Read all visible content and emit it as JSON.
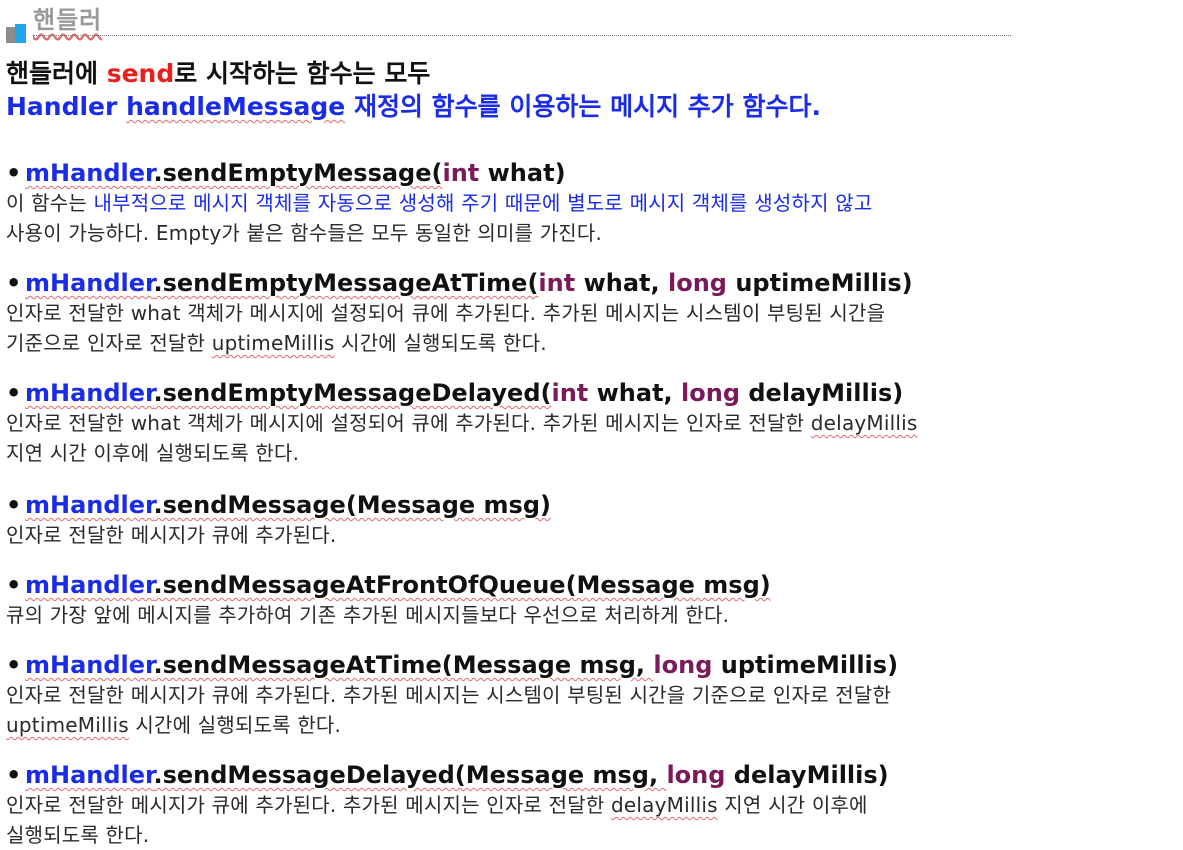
{
  "header": {
    "title": "핸들러"
  },
  "intro": {
    "line1_before": "핸들러에 ",
    "line1_accent": "send",
    "line1_after": "로 시작하는 함수는 모두",
    "line2_word1": "Handler",
    "line2_word2": "handleMessage",
    "line2_rest": " 재정의 함수를 이용하는 메시지 추가 함수다."
  },
  "methods": [
    {
      "object": "mHandler",
      "name": ".sendEmptyMessage(",
      "kw1": "int",
      "mid": " what)",
      "desc1_plain": "이 함수는 ",
      "desc1_blue": "내부적으로 메시지 객체를 자동으로 생성해 주기 때문에 별도로 메시지 객체를 생성하지 않고",
      "desc2": "사용이 가능하다. Empty가 붙은 함수들은 모두 동일한 의미를 가진다."
    },
    {
      "object": "mHandler",
      "name": ".sendEmptyMessageAtTime(",
      "kw1": "int",
      "mid": " what, ",
      "kw2": "long",
      "tail": " uptimeMillis)",
      "desc1": "인자로 전달한 what 객체가 메시지에 설정되어 큐에 추가된다. 추가된 메시지는 시스템이 부팅된 시간을",
      "desc2_before": "기준으로 인자로 전달한 ",
      "desc2_term": "uptimeMillis",
      "desc2_after": " 시간에 실행되도록 한다."
    },
    {
      "object": "mHandler",
      "name": ".sendEmptyMessageDelayed(",
      "kw1": "int",
      "mid": " what, ",
      "kw2": "long",
      "tail": " delayMillis)",
      "desc1_before": "인자로 전달한 what 객체가 메시지에 설정되어 큐에 추가된다. 추가된 메시지는 인자로 전달한 ",
      "desc1_term": "delayMillis",
      "desc2": "지연 시간 이후에 실행되도록 한다."
    },
    {
      "object": "mHandler",
      "name": ".sendMessage(Message msg)",
      "desc1": "인자로 전달한 메시지가 큐에 추가된다."
    },
    {
      "object": "mHandler",
      "name": ".sendMessageAtFrontOfQueue(Message msg)",
      "desc1": "큐의 가장 앞에 메시지를 추가하여 기존 추가된 메시지들보다 우선으로 처리하게 한다."
    },
    {
      "object": "mHandler",
      "name": ".sendMessageAtTime(Message msg, ",
      "kw2": "long",
      "tail": " uptimeMillis)",
      "desc1": "인자로 전달한 메시지가 큐에 추가된다. 추가된 메시지는 시스템이 부팅된 시간을 기준으로 인자로 전달한",
      "desc2_term": "uptimeMillis",
      "desc2_after": " 시간에 실행되도록 한다."
    },
    {
      "object": "mHandler",
      "name": ".sendMessageDelayed(Message msg, ",
      "kw2": "long",
      "tail": " delayMillis)",
      "desc1_before": "인자로 전달한 메시지가 큐에 추가된다. 추가된 메시지는 인자로 전달한 ",
      "desc1_term": "delayMillis",
      "desc1_after": " 지연 시간 이후에",
      "desc2": "실행되도록 한다."
    }
  ],
  "colors": {
    "accent_red": "#e8201c",
    "link_blue": "#1a2ce8",
    "keyword_purple": "#7a1a5a",
    "title_gray": "#9a9a9a",
    "deco_blue": "#1fa5e8"
  }
}
